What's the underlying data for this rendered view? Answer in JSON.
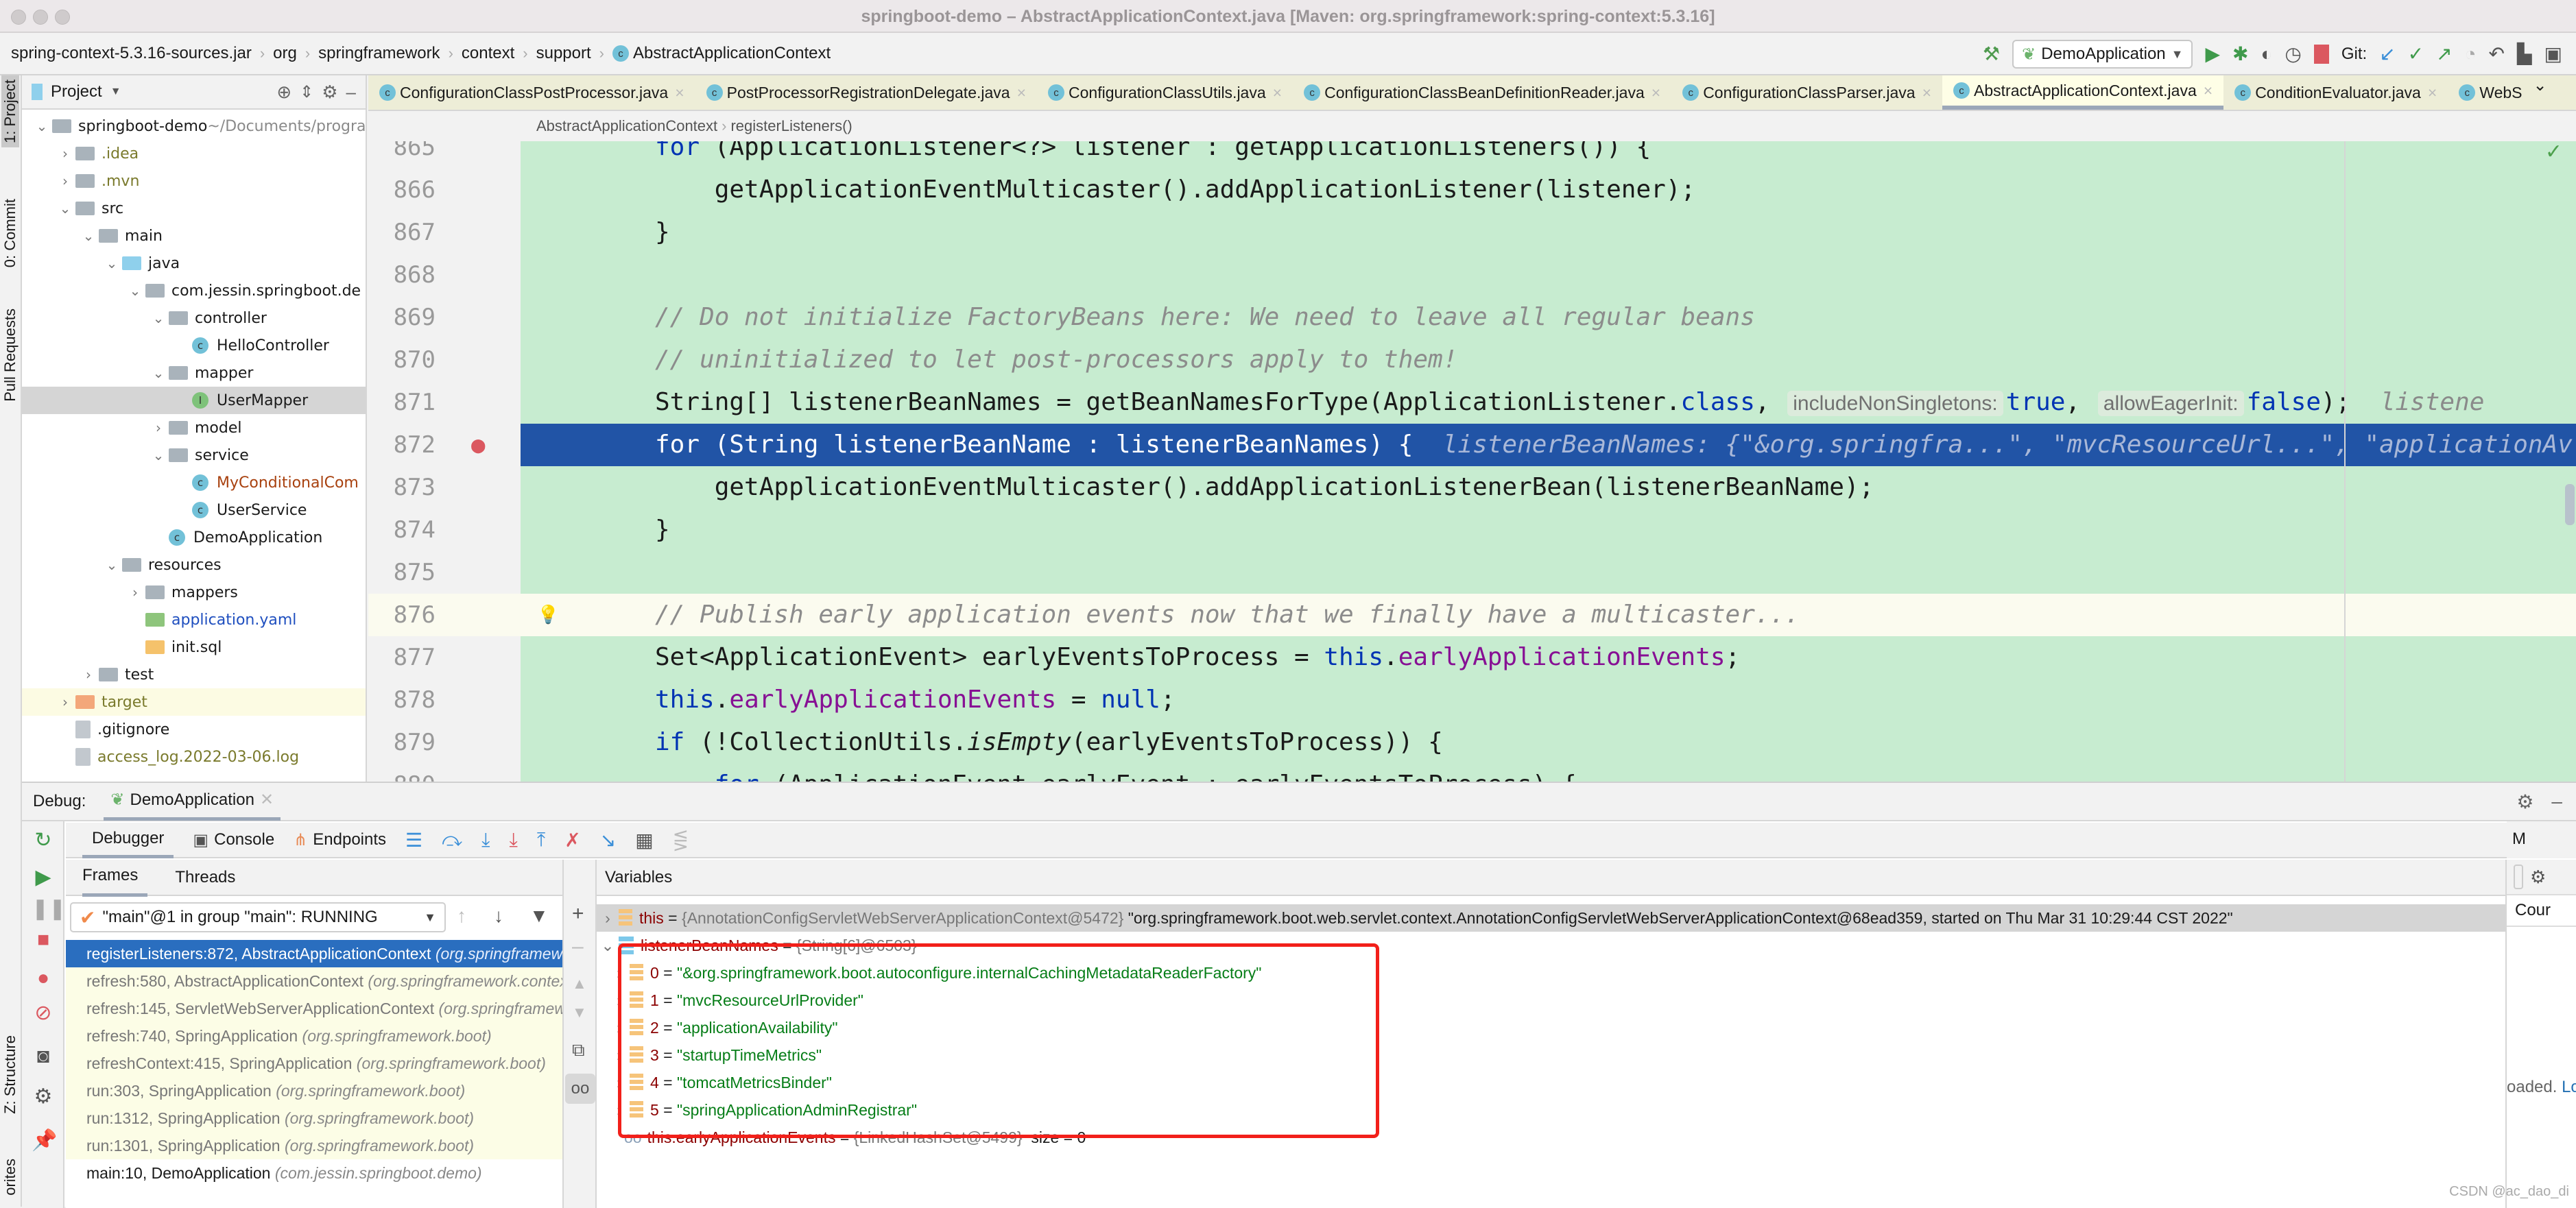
{
  "window": {
    "title": "springboot-demo – AbstractApplicationContext.java [Maven: org.springframework:spring-context:5.3.16]"
  },
  "navbar": {
    "breadcrumbs": [
      "spring-context-5.3.16-sources.jar",
      "org",
      "springframework",
      "context",
      "support",
      "AbstractApplicationContext"
    ],
    "run_config": "DemoApplication",
    "git_label": "Git:"
  },
  "left_strip": {
    "project": "1: Project",
    "commit": "0: Commit",
    "pull_requests": "Pull Requests",
    "structure": "Z: Structure",
    "favorites": "orites"
  },
  "project": {
    "header": "Project",
    "tree": [
      {
        "level": 0,
        "open": true,
        "icon": "module-folder",
        "label": "springboot-demo",
        "suffix": " ~/Documents/progra"
      },
      {
        "level": 1,
        "open": false,
        "icon": "folder",
        "label": ".idea",
        "color": "#7a7a2c"
      },
      {
        "level": 1,
        "open": false,
        "icon": "folder",
        "label": ".mvn",
        "color": "#7a7a2c"
      },
      {
        "level": 1,
        "open": true,
        "icon": "folder",
        "label": "src"
      },
      {
        "level": 2,
        "open": true,
        "icon": "folder",
        "label": "main"
      },
      {
        "level": 3,
        "open": true,
        "icon": "source-folder",
        "label": "java"
      },
      {
        "level": 4,
        "open": true,
        "icon": "package",
        "label": "com.jessin.springboot.de"
      },
      {
        "level": 5,
        "open": true,
        "icon": "package",
        "label": "controller"
      },
      {
        "level": 6,
        "icon": "class",
        "label": "HelloController"
      },
      {
        "level": 5,
        "open": true,
        "icon": "package",
        "label": "mapper"
      },
      {
        "level": 6,
        "icon": "interface",
        "label": "UserMapper",
        "selected": true
      },
      {
        "level": 5,
        "open": false,
        "icon": "package",
        "label": "model"
      },
      {
        "level": 5,
        "open": true,
        "icon": "package",
        "label": "service"
      },
      {
        "level": 6,
        "icon": "class",
        "label": "MyConditionalCom",
        "color": "#a8410f"
      },
      {
        "level": 6,
        "icon": "class",
        "label": "UserService"
      },
      {
        "level": 5,
        "icon": "spring-class",
        "label": "DemoApplication"
      },
      {
        "level": 3,
        "open": true,
        "icon": "resource-folder",
        "label": "resources"
      },
      {
        "level": 4,
        "open": false,
        "icon": "folder",
        "label": "mappers"
      },
      {
        "level": 4,
        "icon": "yaml",
        "label": "application.yaml",
        "color": "#1f4fbf"
      },
      {
        "level": 4,
        "icon": "sql",
        "label": "init.sql"
      },
      {
        "level": 2,
        "open": false,
        "icon": "folder",
        "label": "test"
      },
      {
        "level": 1,
        "open": false,
        "icon": "excluded-folder",
        "label": "target",
        "color": "#7a7a2c",
        "highlight": true
      },
      {
        "level": 1,
        "icon": "ignore-file",
        "label": ".gitignore"
      },
      {
        "level": 1,
        "icon": "log-file",
        "label": "access_log.2022-03-06.log",
        "color": "#7a7a2c"
      }
    ]
  },
  "editor": {
    "tabs": [
      {
        "label": "ConfigurationClassPostProcessor.java"
      },
      {
        "label": "PostProcessorRegistrationDelegate.java"
      },
      {
        "label": "ConfigurationClassUtils.java"
      },
      {
        "label": "ConfigurationClassBeanDefinitionReader.java"
      },
      {
        "label": "ConfigurationClassParser.java"
      },
      {
        "label": "AbstractApplicationContext.java",
        "active": true
      },
      {
        "label": "ConditionEvaluator.java"
      },
      {
        "label": "WebS"
      }
    ],
    "breadcrumb": [
      "AbstractApplicationContext",
      "registerListeners()"
    ],
    "lines": [
      {
        "n": "865",
        "segs": [
          [
            "for",
            "kw"
          ],
          [
            " (ApplicationListener<?> listener : getApplicationListeners()) {",
            ""
          ]
        ]
      },
      {
        "n": "866",
        "segs": [
          [
            "    getApplicationEventMulticaster().addApplicationListener(listener);",
            ""
          ]
        ]
      },
      {
        "n": "867",
        "segs": [
          [
            "}",
            ""
          ]
        ]
      },
      {
        "n": "868",
        "segs": []
      },
      {
        "n": "869",
        "segs": [
          [
            "// Do not initialize FactoryBeans here: We need to leave all regular beans",
            "cm"
          ]
        ]
      },
      {
        "n": "870",
        "segs": [
          [
            "// uninitialized to let post-processors apply to them!",
            "cm"
          ]
        ]
      },
      {
        "n": "871",
        "segs": [
          [
            "String[] listenerBeanNames = getBeanNamesForType(ApplicationListener.",
            ""
          ],
          [
            "class",
            "kw"
          ],
          [
            ", ",
            ""
          ],
          [
            "includeNonSingletons:",
            "hint"
          ],
          [
            "true",
            "kw"
          ],
          [
            ", ",
            ""
          ],
          [
            "allowEagerInit:",
            "hint"
          ],
          [
            "false",
            "kw"
          ],
          [
            ");  ",
            ""
          ],
          [
            "listene",
            "dbg"
          ]
        ]
      },
      {
        "n": "872",
        "exec": true,
        "segs": [
          [
            "for",
            "kw"
          ],
          [
            " (String listenerBeanName : listenerBeanNames) {  ",
            ""
          ],
          [
            "listenerBeanNames: {\"&org.springfra...\", \"mvcResourceUrl...\", \"applicationAv",
            "dbg"
          ]
        ]
      },
      {
        "n": "873",
        "segs": [
          [
            "    getApplicationEventMulticaster().addApplicationListenerBean(listenerBeanName);",
            ""
          ]
        ]
      },
      {
        "n": "874",
        "segs": [
          [
            "}",
            ""
          ]
        ]
      },
      {
        "n": "875",
        "segs": []
      },
      {
        "n": "876",
        "caret": true,
        "segs": [
          [
            "// Publish early application events now that we finally have a multicaster...",
            "cm"
          ]
        ]
      },
      {
        "n": "877",
        "segs": [
          [
            "Set<ApplicationEvent> earlyEventsToProcess = ",
            ""
          ],
          [
            "this",
            "kw"
          ],
          [
            ".",
            ""
          ],
          [
            "earlyApplicationEvents",
            "fld"
          ],
          [
            ";",
            ""
          ]
        ]
      },
      {
        "n": "878",
        "segs": [
          [
            "this",
            "kw"
          ],
          [
            ".",
            ""
          ],
          [
            "earlyApplicationEvents",
            "fld"
          ],
          [
            " = ",
            ""
          ],
          [
            "null",
            "kw"
          ],
          [
            ";",
            ""
          ]
        ]
      },
      {
        "n": "879",
        "segs": [
          [
            "if",
            "kw"
          ],
          [
            " (!CollectionUtils.",
            ""
          ],
          [
            "isEmpty",
            "it"
          ],
          [
            "(earlyEventsToProcess)) {",
            ""
          ]
        ]
      },
      {
        "n": "880",
        "segs": [
          [
            "    ",
            ""
          ],
          [
            "for",
            "kw"
          ],
          [
            " (ApplicationEvent earlyEvent : earlyEventsToProcess) {",
            ""
          ]
        ]
      }
    ]
  },
  "debug": {
    "label": "Debug:",
    "session": "DemoApplication",
    "tabs": {
      "debugger": "Debugger",
      "console": "Console",
      "endpoints": "Endpoints"
    },
    "frames_tab": "Frames",
    "threads_tab": "Threads",
    "thread": "\"main\"@1 in group \"main\": RUNNING",
    "frames": [
      {
        "m": "registerListeners:872, AbstractApplicationContext",
        "p": "(org.springframework.context.support)",
        "sel": true
      },
      {
        "m": "refresh:580, AbstractApplicationContext",
        "p": "(org.springframework.context.support)"
      },
      {
        "m": "refresh:145, ServletWebServerApplicationContext",
        "p": "(org.springframework.boot.web.servlet.context)"
      },
      {
        "m": "refresh:740, SpringApplication",
        "p": "(org.springframework.boot)"
      },
      {
        "m": "refreshContext:415, SpringApplication",
        "p": "(org.springframework.boot)"
      },
      {
        "m": "run:303, SpringApplication",
        "p": "(org.springframework.boot)"
      },
      {
        "m": "run:1312, SpringApplication",
        "p": "(org.springframework.boot)"
      },
      {
        "m": "run:1301, SpringApplication",
        "p": "(org.springframework.boot)"
      },
      {
        "m": "main:10, DemoApplication",
        "p": "(com.jessin.springboot.demo)",
        "plain": true
      }
    ],
    "variables_label": "Variables",
    "variables": {
      "this": {
        "name": "this",
        "type": "{AnnotationConfigServletWebServerApplicationContext@5472}",
        "value": "\"org.springframework.boot.web.servlet.context.AnnotationConfigServletWebServerApplicationContext@68ead359, started on Thu Mar 31 10:29:44 CST 2022\""
      },
      "array": {
        "name": "listenerBeanNames",
        "type": "{String[6]@6503}"
      },
      "items": [
        {
          "i": "0",
          "v": "\"&org.springframework.boot.autoconfigure.internalCachingMetadataReaderFactory\""
        },
        {
          "i": "1",
          "v": "\"mvcResourceUrlProvider\""
        },
        {
          "i": "2",
          "v": "\"applicationAvailability\""
        },
        {
          "i": "3",
          "v": "\"startupTimeMetrics\""
        },
        {
          "i": "4",
          "v": "\"tomcatMetricsBinder\""
        },
        {
          "i": "5",
          "v": "\"springApplicationAdminRegistrar\""
        }
      ],
      "watch": {
        "name": "this.earlyApplicationEvents",
        "type": "{LinkedHashSet@5499}",
        "extra": "size = 0"
      }
    },
    "right": {
      "header": "M",
      "count": "Cour",
      "loaded": "oaded.",
      "link": "Lo"
    }
  },
  "watermark": "CSDN @ac_dao_di",
  "colors": {
    "accent": "#2154a6",
    "editor_bg": "#c7ecd0",
    "highlight_box": "#f2201a"
  }
}
